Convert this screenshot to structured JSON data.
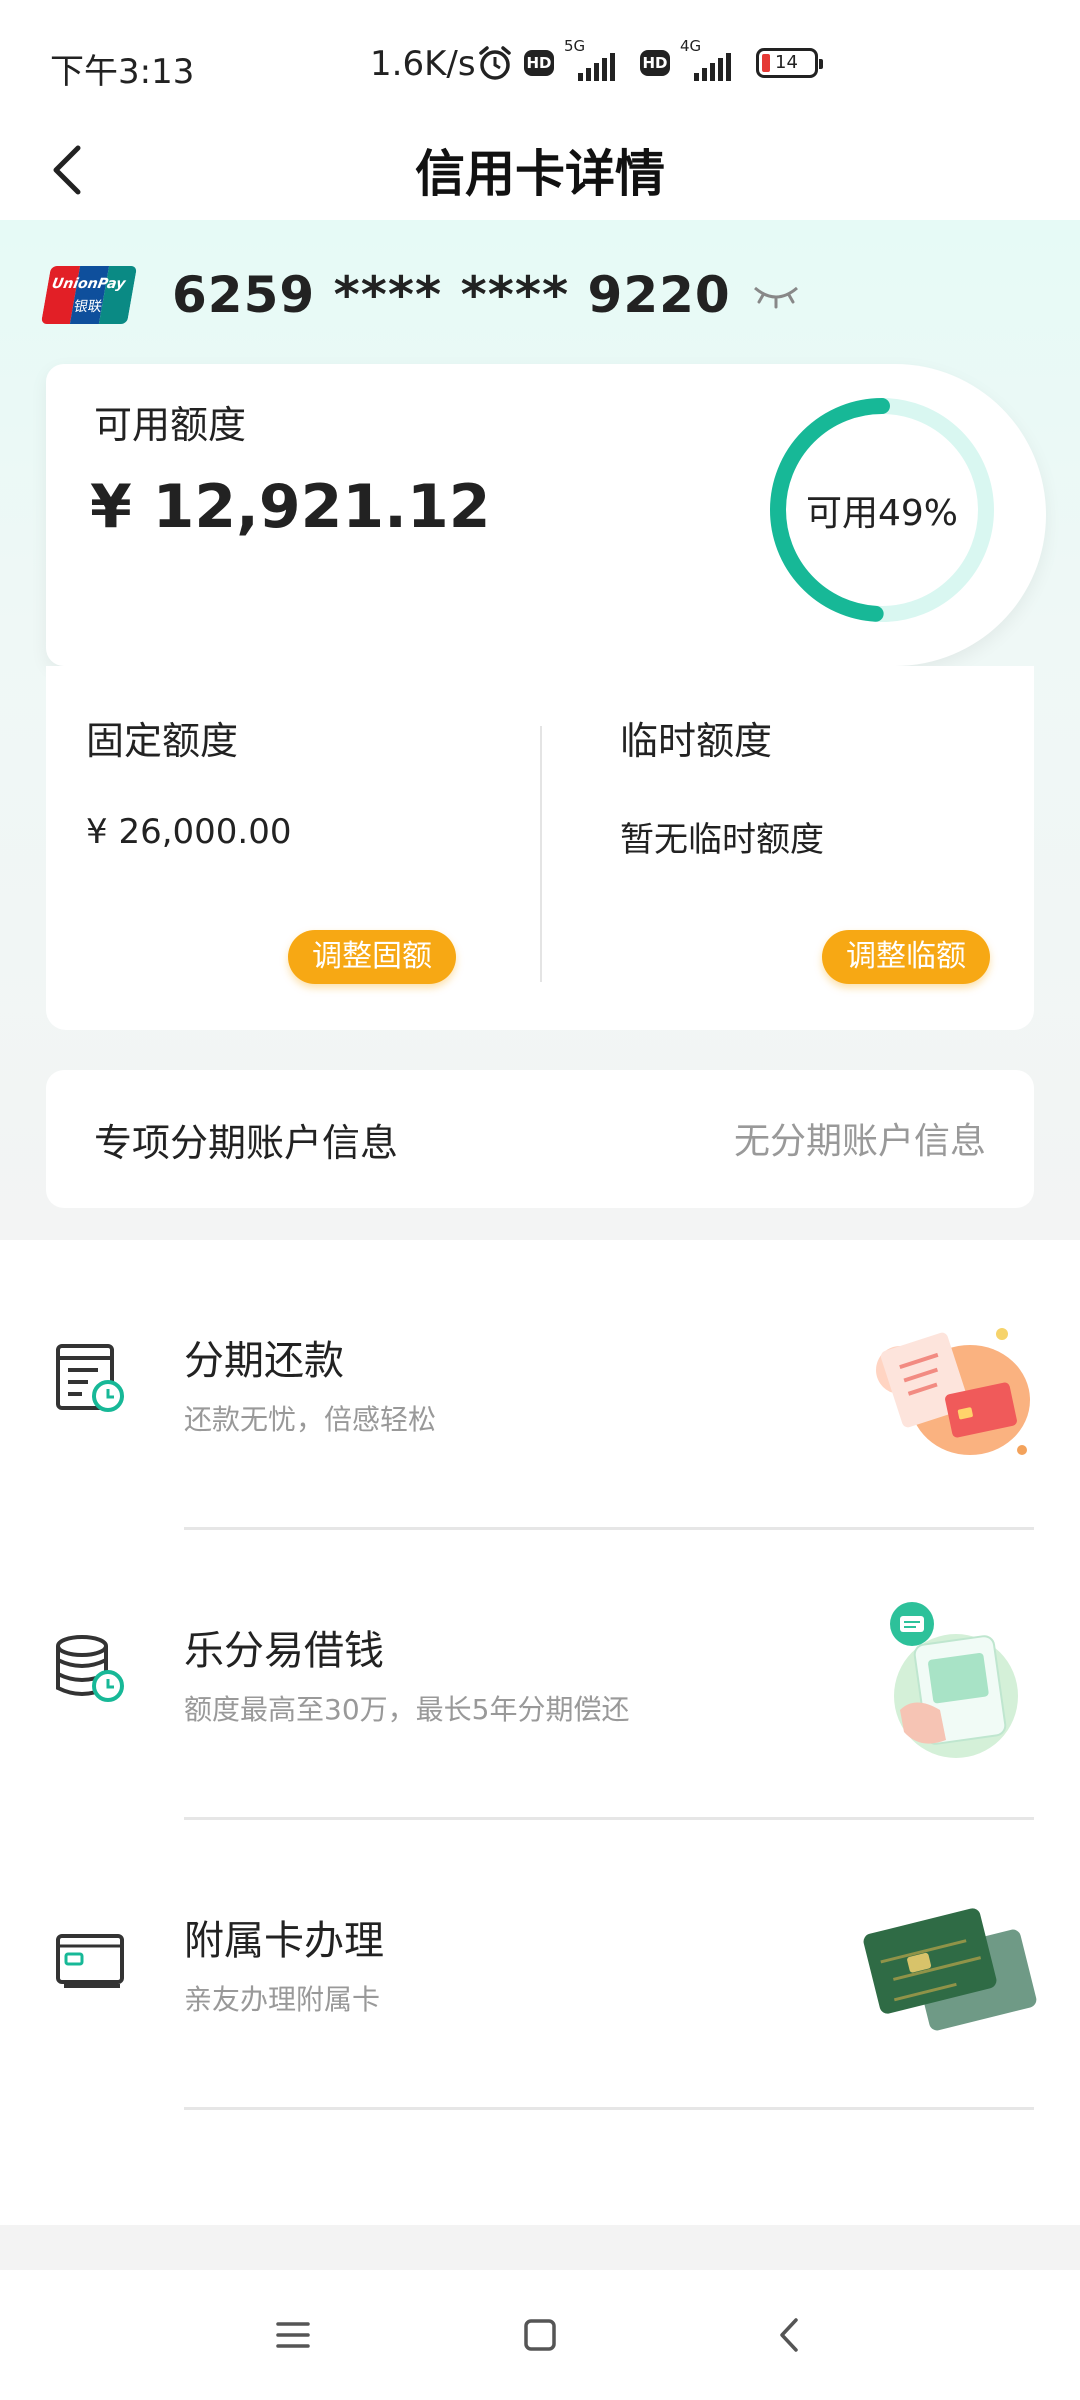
{
  "status_bar": {
    "time": "下午3:13",
    "speed": "1.6K/s",
    "icons": [
      "alarm-icon",
      "hd-icon",
      "signal-5g-icon",
      "hd-icon",
      "signal-4g-icon",
      "battery-icon"
    ],
    "hd_label": "HD",
    "net1_label": "5G",
    "net2_label": "4G",
    "battery_level": "14"
  },
  "header": {
    "title": "信用卡详情",
    "back_icon": "chevron-left-icon"
  },
  "card": {
    "number": "6259 **** **** 9220",
    "logo_text": "UnionPay",
    "logo_text_cn": "银联",
    "eye_icon": "eye-closed-icon"
  },
  "available": {
    "label": "可用额度",
    "amount": "¥ 12,921.12",
    "ring_text": "可用49%",
    "ring_percent": 49,
    "ring_color": "#17b897",
    "ring_track_color": "#d9f7f1"
  },
  "quota": {
    "fixed_label": "固定额度",
    "fixed_value": "¥ 26,000.00",
    "fixed_button": "调整固额",
    "temp_label": "临时额度",
    "temp_value": "暂无临时额度",
    "temp_button": "调整临额",
    "button_color": "#f7a814"
  },
  "installment_account": {
    "label": "专项分期账户信息",
    "value": "无分期账户信息"
  },
  "services": [
    {
      "title": "分期还款",
      "desc": "还款无忧，倍感轻松",
      "icon": "bill-clock-icon"
    },
    {
      "title": "乐分易借钱",
      "desc": "额度最高至30万，最长5年分期偿还",
      "icon": "coins-clock-icon"
    },
    {
      "title": "附属卡办理",
      "desc": "亲友办理附属卡",
      "icon": "card-icon"
    }
  ],
  "nav": {
    "menu_icon": "menu-icon",
    "home_icon": "home-square-icon",
    "back_icon": "back-triangle-icon"
  }
}
